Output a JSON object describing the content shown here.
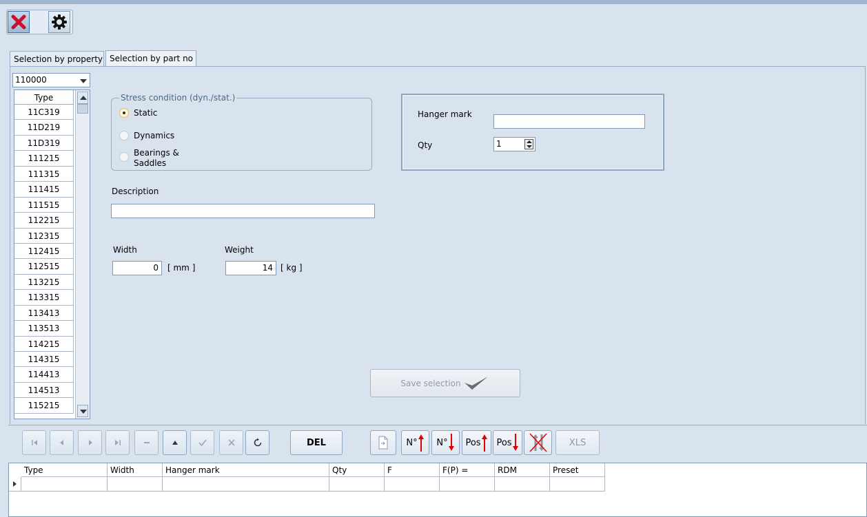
{
  "tabs": [
    {
      "label": "Selection by property"
    },
    {
      "label": "Selection by part no"
    }
  ],
  "type_combo": {
    "value": "110000"
  },
  "type_grid": {
    "header": "Type",
    "rows": [
      "11C319",
      "11D219",
      "11D319",
      "111215",
      "111315",
      "111415",
      "111515",
      "112215",
      "112315",
      "112415",
      "112515",
      "113215",
      "113315",
      "113413",
      "113513",
      "114215",
      "114315",
      "114413",
      "114513",
      "115215"
    ]
  },
  "stress": {
    "legend": "Stress condition (dyn./stat.)",
    "options": [
      {
        "label": "Static",
        "checked": true
      },
      {
        "label": "Dynamics",
        "checked": false
      },
      {
        "label_line1": "Bearings &",
        "label_line2": "Saddles",
        "checked": false
      }
    ]
  },
  "description": {
    "label": "Description",
    "value": ""
  },
  "width": {
    "label": "Width",
    "value": "0",
    "unit": "[ mm ]"
  },
  "weight": {
    "label": "Weight",
    "value": "14",
    "unit": "[ kg ]"
  },
  "hanger": {
    "mark_label": "Hanger mark",
    "mark_value": "",
    "qty_label": "Qty",
    "qty_value": "1"
  },
  "save_button": {
    "label": "Save selection"
  },
  "navigator": {
    "del_label": "DEL",
    "n_up_label": "N°",
    "n_down_label": "N°",
    "pos_up_label": "Pos",
    "pos_down_label": "Pos",
    "xls_label": "XLS"
  },
  "selection_table": {
    "columns": [
      "Type",
      "Width",
      "Hanger mark",
      "Qty",
      "F",
      "F(P) =",
      "RDM",
      "Preset"
    ]
  },
  "colors": {
    "close_red": "#c8102e",
    "arrow_red": "#e00000",
    "accent": "#3c6ea4"
  }
}
